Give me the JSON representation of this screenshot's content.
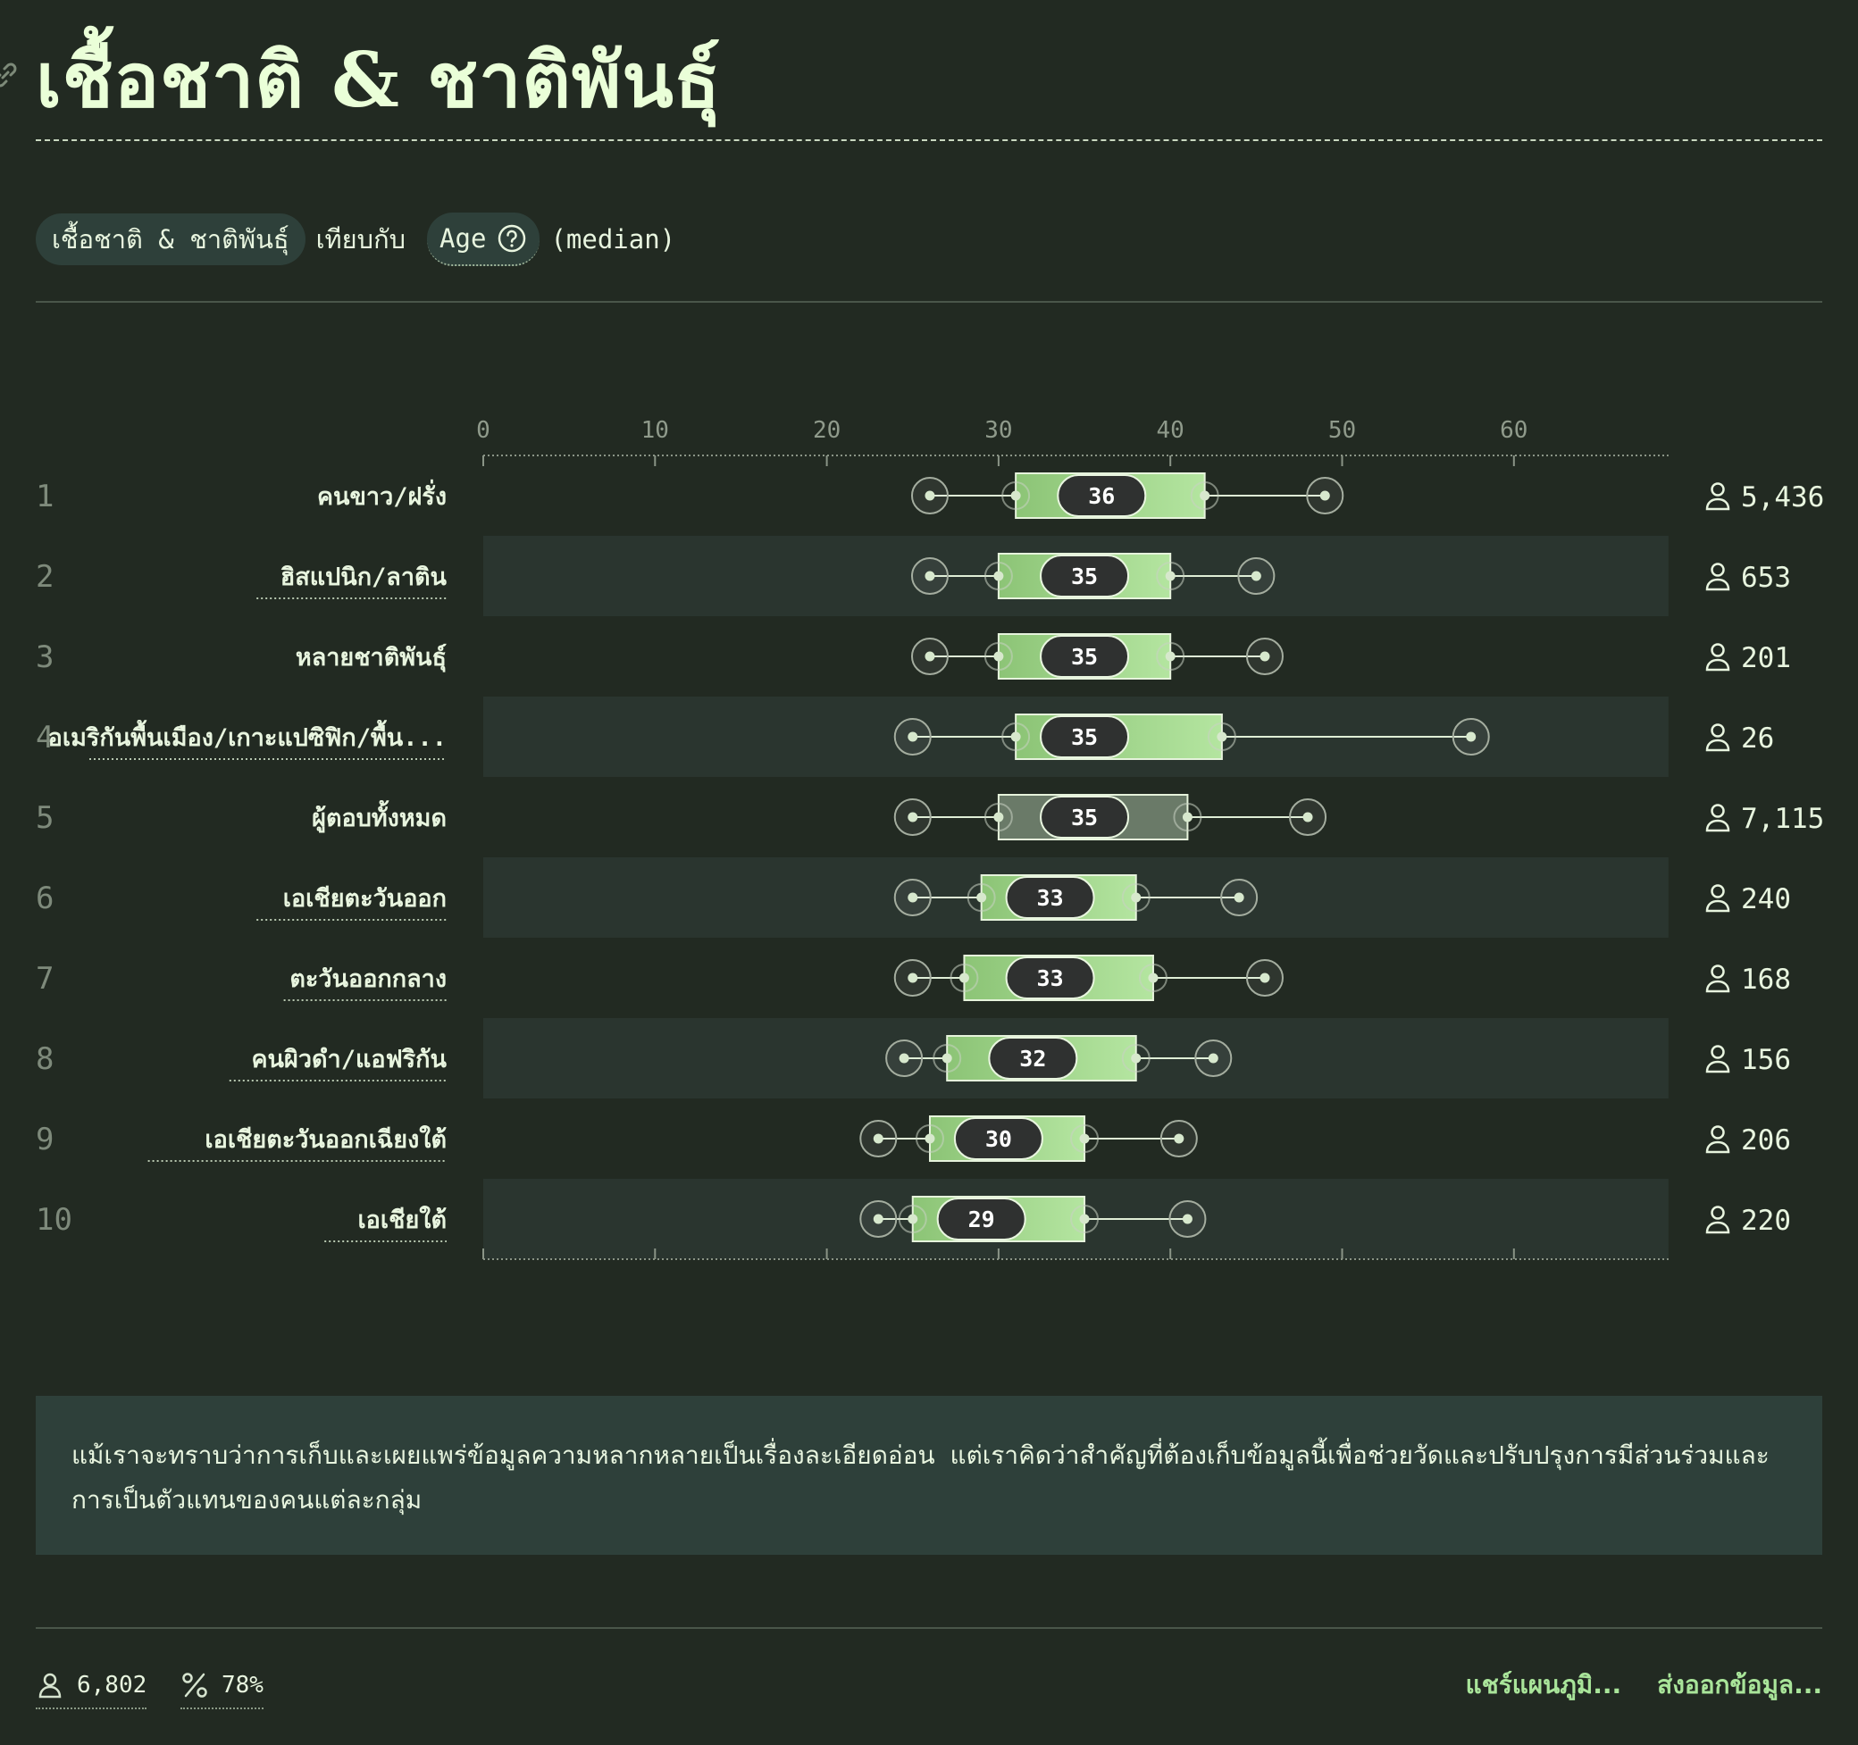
{
  "header": {
    "title": "เชื้อชาติ & ชาติพันธุ์",
    "subtitle_category": "เชื้อชาติ & ชาติพันธุ์",
    "subtitle_vs": "เทียบกับ",
    "subtitle_metric": "Age",
    "subtitle_stat": "(median)"
  },
  "note": "แม้เราจะทราบว่าการเก็บและเผยแพร่ข้อมูลความหลากหลายเป็นเรื่องละเอียดอ่อน แต่เราคิดว่าสำคัญที่ต้องเก็บข้อมูลนี้เพื่อช่วยวัดและปรับปรุงการมีส่วนร่วมและการเป็นตัวแทนของคนแต่ละกลุ่ม",
  "footer": {
    "respondents": "6,802",
    "percent": "78%",
    "share_label": "แชร์แผนภูมิ...",
    "export_label": "ส่งออกข้อมูล..."
  },
  "colors": {
    "background": "#222a22",
    "band": "#2a352f",
    "box_light": "#b4e5a0",
    "box_dark": "#8cc476",
    "neutral_box": "#6a7a68",
    "median_pill": "#2f3130",
    "accent_text": "#a9e59a"
  },
  "chart_data": {
    "type": "boxplot",
    "orientation": "horizontal",
    "xlim": [
      0,
      69
    ],
    "xticks": [
      0,
      10,
      20,
      30,
      40,
      50,
      60
    ],
    "grid": false,
    "rows": [
      {
        "rank": "1",
        "label": "คนขาว/ฝรั่ง",
        "min": 26,
        "q1": 31,
        "median": 36,
        "q3": 42,
        "max": 49,
        "count": "5,436",
        "underline": false,
        "neutral": false
      },
      {
        "rank": "2",
        "label": "ฮิสแปนิก/ลาติน",
        "min": 26,
        "q1": 30,
        "median": 35,
        "q3": 40,
        "max": 45,
        "count": "653",
        "underline": true,
        "neutral": false
      },
      {
        "rank": "3",
        "label": "หลายชาติพันธุ์",
        "min": 26,
        "q1": 30,
        "median": 35,
        "q3": 40,
        "max": 45.5,
        "count": "201",
        "underline": false,
        "neutral": false
      },
      {
        "rank": "4",
        "label": "อเมริกันพื้นเมือง/เกาะแปซิฟิก/พื้น...",
        "min": 25,
        "q1": 31,
        "median": 35,
        "q3": 43,
        "max": 57.5,
        "count": "26",
        "underline": true,
        "neutral": false
      },
      {
        "rank": "5",
        "label": "ผู้ตอบทั้งหมด",
        "min": 25,
        "q1": 30,
        "median": 35,
        "q3": 41,
        "max": 48,
        "count": "7,115",
        "underline": false,
        "neutral": true
      },
      {
        "rank": "6",
        "label": "เอเชียตะวันออก",
        "min": 25,
        "q1": 29,
        "median": 33,
        "q3": 38,
        "max": 44,
        "count": "240",
        "underline": true,
        "neutral": false
      },
      {
        "rank": "7",
        "label": "ตะวันออกกลาง",
        "min": 25,
        "q1": 28,
        "median": 33,
        "q3": 39,
        "max": 45.5,
        "count": "168",
        "underline": true,
        "neutral": false
      },
      {
        "rank": "8",
        "label": "คนผิวดำ/แอฟริกัน",
        "min": 24.5,
        "q1": 27,
        "median": 32,
        "q3": 38,
        "max": 42.5,
        "count": "156",
        "underline": true,
        "neutral": false
      },
      {
        "rank": "9",
        "label": "เอเชียตะวันออกเฉียงใต้",
        "min": 23,
        "q1": 26,
        "median": 30,
        "q3": 35,
        "max": 40.5,
        "count": "206",
        "underline": true,
        "neutral": false
      },
      {
        "rank": "10",
        "label": "เอเชียใต้",
        "min": 23,
        "q1": 25,
        "median": 29,
        "q3": 35,
        "max": 41,
        "count": "220",
        "underline": true,
        "neutral": false
      }
    ]
  }
}
